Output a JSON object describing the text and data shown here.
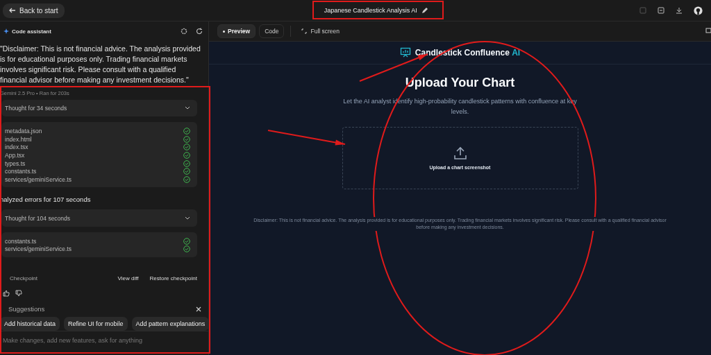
{
  "topbar": {
    "back_button": "Back to start",
    "title": "Japanese Candlestick Analysis AI"
  },
  "assistant": {
    "title": "Code assistant",
    "message": "\"Disclaimer: This is not financial advice. The analysis provided is for educational purposes only. Trading financial markets involves significant risk. Please consult with a qualified financial advisor before making any investment decisions.\"",
    "meta": "Gemini 2.5 Pro  •  Ran for 203s",
    "blocks": [
      {
        "kind": "thought",
        "label": "Thought for 34 seconds",
        "expanded": false
      },
      {
        "kind": "files",
        "files": [
          {
            "name": "metadata.json",
            "done": true
          },
          {
            "name": "index.html",
            "done": true
          },
          {
            "name": "index.tsx",
            "done": true
          },
          {
            "name": "App.tsx",
            "done": true
          },
          {
            "name": "types.ts",
            "done": true
          },
          {
            "name": "constants.ts",
            "done": true
          },
          {
            "name": "services/geminiService.ts",
            "done": true
          }
        ]
      },
      {
        "kind": "heading",
        "label": "nalyzed errors for 107 seconds"
      },
      {
        "kind": "thought",
        "label": "Thought for 104 seconds",
        "expanded": false
      },
      {
        "kind": "files",
        "files": [
          {
            "name": "constants.ts",
            "done": true
          },
          {
            "name": "services/geminiService.ts",
            "done": true
          }
        ]
      }
    ],
    "checkpoint": {
      "label": "Checkpoint",
      "view_diff": "View diff",
      "restore": "Restore checkpoint"
    },
    "suggestions": {
      "title": "Suggestions",
      "chips": [
        "Add historical data",
        "Refine UI for mobile",
        "Add pattern explanations"
      ]
    },
    "input": {
      "placeholder": "Make changes, add new features, ask for anything"
    }
  },
  "preview": {
    "tabs": [
      {
        "label": "Preview",
        "selected": true
      },
      {
        "label": "Code",
        "selected": false
      }
    ],
    "fullscreen": "Full screen",
    "app": {
      "brand": "Candlestick Confluence",
      "brand_accent": "AI",
      "heading": "Upload Your Chart",
      "subtitle": "Let the AI analyst identify high-probability candlestick patterns with confluence at key levels.",
      "dropzone_label": "Upload a chart screenshot",
      "disclaimer": "Disclaimer: This is not financial advice. The analysis provided is for educational purposes only. Trading financial markets involves significant risk. Please consult with a qualified financial advisor before making any investment decisions."
    }
  },
  "annotations": [
    {
      "kind": "frame"
    },
    {
      "kind": "frame"
    },
    {
      "kind": "ellipse"
    },
    {
      "kind": "arrow"
    },
    {
      "kind": "arrow"
    }
  ]
}
